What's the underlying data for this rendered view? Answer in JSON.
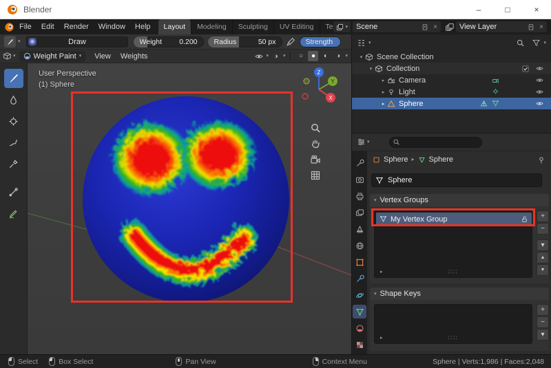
{
  "titlebar": {
    "title": "Blender",
    "minimize": "–",
    "maximize": "□",
    "close": "×"
  },
  "topbar": {
    "menus": [
      "File",
      "Edit",
      "Render",
      "Window",
      "Help"
    ],
    "tabs": [
      {
        "label": "Layout"
      },
      {
        "label": "Modeling"
      },
      {
        "label": "Sculpting"
      },
      {
        "label": "UV Editing"
      },
      {
        "label": "Texture Paint"
      }
    ],
    "active_tab": "Layout",
    "scene": {
      "value": "Scene"
    },
    "view_layer": {
      "value": "View Layer"
    }
  },
  "tool_settings": {
    "brush_name": "Draw",
    "weight_label": "Weight",
    "weight_value": "0.200",
    "radius_label": "Radius",
    "radius_value": "50 px",
    "strength_label": "Strength"
  },
  "viewport_header": {
    "mode": "Weight Paint",
    "menu_view": "View",
    "menu_weights": "Weights"
  },
  "viewport": {
    "overlay_line1": "User Perspective",
    "overlay_line2": "(1) Sphere",
    "gizmo": {
      "x": "X",
      "y": "Y",
      "z": "Z"
    }
  },
  "outliner": {
    "rows": [
      {
        "label": "Scene Collection"
      },
      {
        "label": "Collection"
      },
      {
        "label": "Camera"
      },
      {
        "label": "Light"
      },
      {
        "label": "Sphere"
      }
    ]
  },
  "properties": {
    "breadcrumb_object": "Sphere",
    "breadcrumb_data": "Sphere",
    "name_value": "Sphere",
    "vertex_groups_title": "Vertex Groups",
    "vertex_group_item": "My Vertex Group",
    "shape_keys_title": "Shape Keys"
  },
  "statusbar": {
    "hint_select": "Select",
    "hint_box_select": "Box Select",
    "hint_pan": "Pan View",
    "hint_context": "Context Menu",
    "stats": "Sphere | Verts:1,986 | Faces:2,048"
  },
  "icons": {
    "caret": "▾",
    "expand_open": "▾",
    "expand_closed": "▸",
    "plus": "+",
    "minus": "−",
    "up": "▲",
    "down": "▼",
    "close": "×",
    "grip": "∷∷",
    "shade_wire": "○",
    "shade_solid": "●",
    "shade_material": "◐",
    "shade_render": "◑",
    "breadcrumb_sep": "▸"
  },
  "colors": {
    "accent": "#4772b3",
    "selection_blue": "#3d66a0",
    "annotation_red": "#ec3128",
    "axis_x": "#e0434f",
    "axis_y": "#7aa82d",
    "axis_z": "#3a6fe0",
    "weight_low": "#1b26b4",
    "weight_high": "#ee1111"
  }
}
